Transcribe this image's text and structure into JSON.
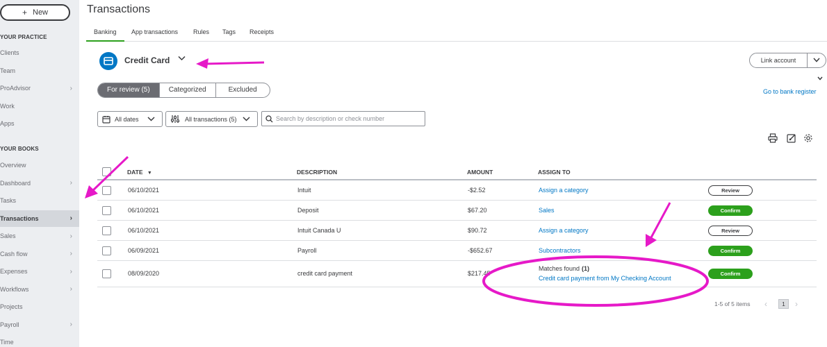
{
  "sidebar": {
    "new_button": "New",
    "practice_heading": "YOUR PRACTICE",
    "practice_items": [
      {
        "label": "Clients",
        "chevron": false
      },
      {
        "label": "Team",
        "chevron": false
      },
      {
        "label": "ProAdvisor",
        "chevron": true
      },
      {
        "label": "Work",
        "chevron": false
      },
      {
        "label": "Apps",
        "chevron": false
      }
    ],
    "books_heading": "YOUR BOOKS",
    "books_items": [
      {
        "label": "Overview",
        "chevron": false
      },
      {
        "label": "Dashboard",
        "chevron": true
      },
      {
        "label": "Tasks",
        "chevron": false
      },
      {
        "label": "Transactions",
        "chevron": true,
        "active": true
      },
      {
        "label": "Sales",
        "chevron": true
      },
      {
        "label": "Cash flow",
        "chevron": true
      },
      {
        "label": "Expenses",
        "chevron": true
      },
      {
        "label": "Workflows",
        "chevron": true
      },
      {
        "label": "Projects",
        "chevron": false
      },
      {
        "label": "Payroll",
        "chevron": true
      },
      {
        "label": "Time",
        "chevron": false
      }
    ]
  },
  "header": {
    "title": "Transactions",
    "tabs": [
      "Banking",
      "App transactions",
      "Rules",
      "Tags",
      "Receipts"
    ]
  },
  "account": {
    "name": "Credit Card",
    "link_account": "Link account",
    "bank_register": "Go to bank register"
  },
  "review_tabs": [
    "For review (5)",
    "Categorized",
    "Excluded"
  ],
  "filters": {
    "dates": "All dates",
    "transactions": "All transactions (5)",
    "search_placeholder": "Search by description or check number"
  },
  "table": {
    "columns": {
      "date": "DATE",
      "description": "DESCRIPTION",
      "amount": "AMOUNT",
      "assign": "ASSIGN TO"
    },
    "rows": [
      {
        "date": "06/10/2021",
        "description": "Intuit",
        "amount": "-$2.52",
        "assign": "Assign a category",
        "action": "Review"
      },
      {
        "date": "06/10/2021",
        "description": "Deposit",
        "amount": "$67.20",
        "assign": "Sales",
        "action": "Confirm"
      },
      {
        "date": "06/10/2021",
        "description": "Intuit Canada U",
        "amount": "$90.72",
        "assign": "Assign a category",
        "action": "Review"
      },
      {
        "date": "06/09/2021",
        "description": "Payroll",
        "amount": "-$652.67",
        "assign": "Subcontractors",
        "action": "Confirm"
      },
      {
        "date": "08/09/2020",
        "description": "credit card payment",
        "amount": "$217.45",
        "match_label": "Matches found",
        "match_count": "(1)",
        "assign": "Credit card payment from My Checking Account",
        "action": "Confirm"
      }
    ]
  },
  "pager": {
    "info": "1-5 of 5 items",
    "page": "1"
  },
  "colors": {
    "accent_green": "#2ca01c",
    "link_blue": "#0077c5",
    "annotation_magenta": "#e619c8"
  }
}
